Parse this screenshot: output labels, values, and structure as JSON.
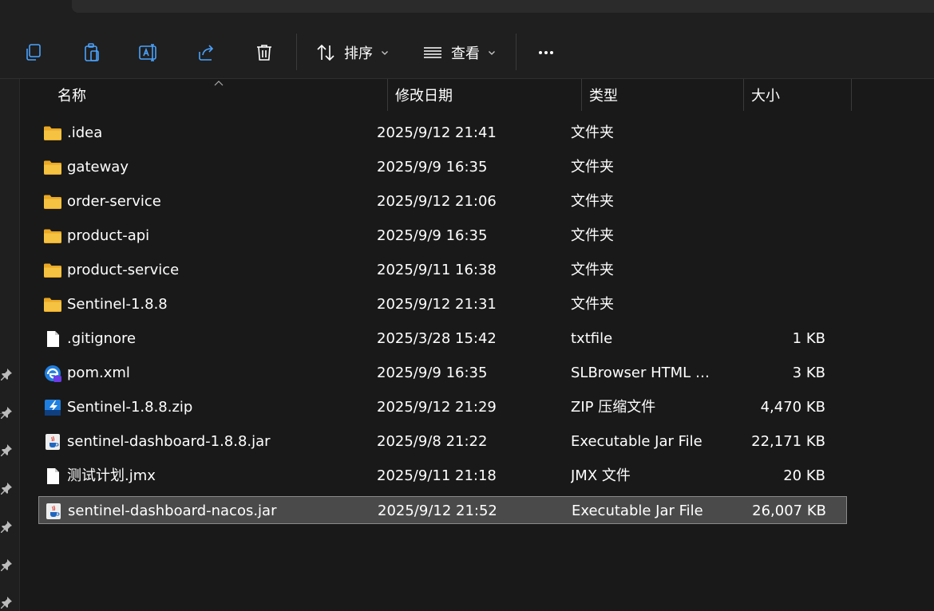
{
  "toolbar": {
    "buttons": [
      {
        "icon": "copy-icon"
      },
      {
        "icon": "paste-icon"
      },
      {
        "icon": "rename-icon"
      },
      {
        "icon": "share-icon"
      },
      {
        "icon": "delete-icon"
      }
    ],
    "sort_label": "排序",
    "view_label": "查看",
    "more_icon": "more-icon"
  },
  "columns": {
    "name": "名称",
    "date": "修改日期",
    "type": "类型",
    "size": "大小"
  },
  "files": [
    {
      "icon": "folder",
      "name": ".idea",
      "date": "2025/9/12 21:41",
      "type": "文件夹",
      "size": ""
    },
    {
      "icon": "folder",
      "name": "gateway",
      "date": "2025/9/9 16:35",
      "type": "文件夹",
      "size": ""
    },
    {
      "icon": "folder",
      "name": "order-service",
      "date": "2025/9/12 21:06",
      "type": "文件夹",
      "size": ""
    },
    {
      "icon": "folder",
      "name": "product-api",
      "date": "2025/9/9 16:35",
      "type": "文件夹",
      "size": ""
    },
    {
      "icon": "folder",
      "name": "product-service",
      "date": "2025/9/11 16:38",
      "type": "文件夹",
      "size": ""
    },
    {
      "icon": "folder",
      "name": "Sentinel-1.8.8",
      "date": "2025/9/12 21:31",
      "type": "文件夹",
      "size": ""
    },
    {
      "icon": "file",
      "name": ".gitignore",
      "date": "2025/3/28 15:42",
      "type": "txtfile",
      "size": "1 KB"
    },
    {
      "icon": "browser",
      "name": "pom.xml",
      "date": "2025/9/9 16:35",
      "type": "SLBrowser HTML D...",
      "size": "3 KB"
    },
    {
      "icon": "zip",
      "name": "Sentinel-1.8.8.zip",
      "date": "2025/9/12 21:29",
      "type": "ZIP 压缩文件",
      "size": "4,470 KB"
    },
    {
      "icon": "jar",
      "name": "sentinel-dashboard-1.8.8.jar",
      "date": "2025/9/8 21:22",
      "type": "Executable Jar File",
      "size": "22,171 KB"
    },
    {
      "icon": "file",
      "name": "测试计划.jmx",
      "date": "2025/9/11 21:18",
      "type": "JMX 文件",
      "size": "20 KB"
    },
    {
      "icon": "jar",
      "name": "sentinel-dashboard-nacos.jar",
      "date": "2025/9/12 21:52",
      "type": "Executable Jar File",
      "size": "26,007 KB",
      "selected": true
    }
  ],
  "colors": {
    "folder": "#f5c242",
    "accent": "#4aa3ff",
    "selected_bg": "#4a4a4a"
  }
}
